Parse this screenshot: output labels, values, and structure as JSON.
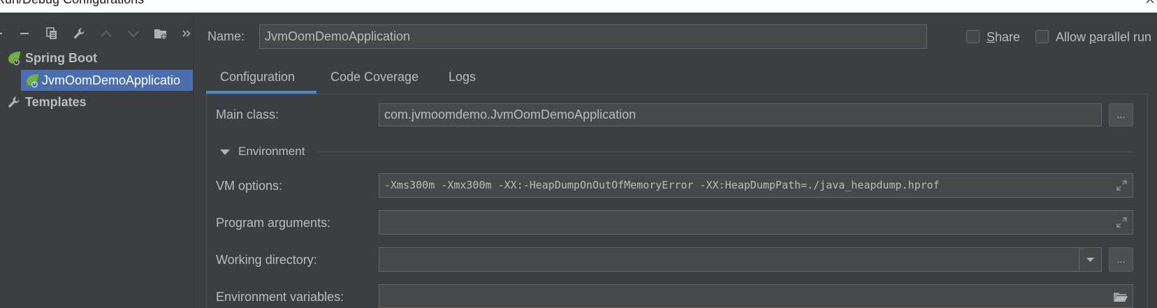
{
  "window": {
    "title": "Run/Debug Configurations",
    "close_icon": "close-icon"
  },
  "colors": {
    "background": "#3c3f41",
    "field_background": "#45494a",
    "field_border": "#646464",
    "text": "#bbbbbb",
    "selection": "#4b6eaf",
    "tab_underline": "#4a88c7",
    "spring_green": "#6db33f"
  },
  "toolbar": {
    "icons": [
      "plus-icon",
      "minus-icon",
      "copy-icon",
      "wrench-icon",
      "arrow-up-icon",
      "arrow-down-icon",
      "folder-add-icon",
      "more-chevrons-icon"
    ],
    "disabled": [
      "arrow-up-icon",
      "arrow-down-icon"
    ]
  },
  "tree": {
    "groups": [
      {
        "label": "Spring Boot",
        "icon": "spring-boot-icon",
        "expanded": true,
        "children": [
          {
            "label": "JvmOomDemoApplicatio",
            "icon": "spring-boot-icon",
            "selected": true
          }
        ]
      },
      {
        "label": "Templates",
        "icon": "wrench-icon"
      }
    ]
  },
  "name_row": {
    "label": "Name:",
    "value": "JvmOomDemoApplication"
  },
  "options": {
    "share": {
      "label": "Share",
      "mnemonic": "S",
      "checked": false
    },
    "parallel": {
      "label": "Allow parallel run",
      "mnemonic": "p",
      "checked": false
    }
  },
  "tabs": [
    {
      "label": "Configuration",
      "selected": true
    },
    {
      "label": "Code Coverage",
      "selected": false
    },
    {
      "label": "Logs",
      "selected": false
    }
  ],
  "configuration": {
    "main_class": {
      "label": "Main class:",
      "value": "com.jvmoomdemo.JvmOomDemoApplication",
      "browse_label": "..."
    },
    "environment": {
      "label": "Environment",
      "expanded": true
    },
    "vm_options": {
      "label": "VM options:",
      "value": "-Xms300m -Xmx300m -XX:-HeapDumpOnOutOfMemoryError -XX:HeapDumpPath=./java_heapdump.hprof",
      "icon": "expand-icon"
    },
    "program_arguments": {
      "label": "Program arguments:",
      "value": "",
      "icon": "expand-icon"
    },
    "working_directory": {
      "label": "Working directory:",
      "value": "",
      "browse_label": "...",
      "icon": "dropdown-arrow-icon"
    },
    "environment_variables": {
      "label": "Environment variables:",
      "value": "",
      "icon": "folder-icon"
    }
  }
}
